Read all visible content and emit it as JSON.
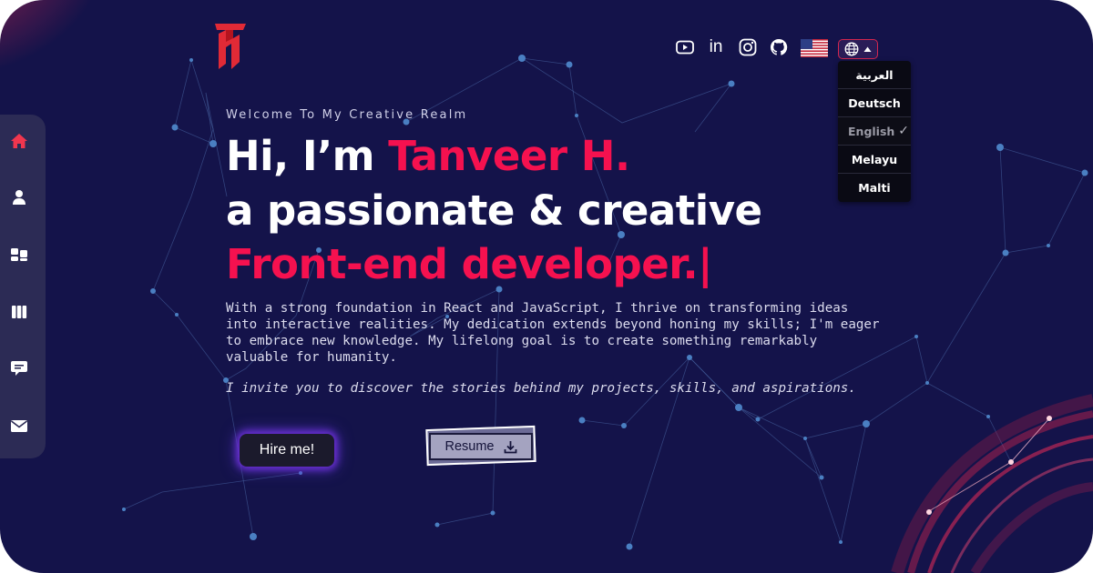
{
  "header": {
    "social": [
      {
        "name": "youtube",
        "icon": "youtube-icon"
      },
      {
        "name": "linkedin",
        "icon": "linkedin-icon",
        "text": "in"
      },
      {
        "name": "instagram",
        "icon": "instagram-icon"
      },
      {
        "name": "github",
        "icon": "github-icon"
      }
    ],
    "flag_icon": "us-flag-icon",
    "language_toggle_icon": "globe-icon",
    "languages": [
      {
        "label": "العربية",
        "selected": false
      },
      {
        "label": "Deutsch",
        "selected": false
      },
      {
        "label": "English",
        "selected": true
      },
      {
        "label": "Melayu",
        "selected": false
      },
      {
        "label": "Malti",
        "selected": false
      }
    ]
  },
  "sidebar": {
    "items": [
      {
        "name": "home",
        "icon": "home-icon",
        "active": true
      },
      {
        "name": "about",
        "icon": "user-icon",
        "active": false
      },
      {
        "name": "services",
        "icon": "dashboard-icon",
        "active": false
      },
      {
        "name": "portfolio",
        "icon": "columns-icon",
        "active": false
      },
      {
        "name": "testimonials",
        "icon": "comment-icon",
        "active": false
      },
      {
        "name": "contact",
        "icon": "mail-icon",
        "active": false
      }
    ]
  },
  "hero": {
    "welcome": "Welcome To My Creative Realm",
    "greeting": "Hi, I’m ",
    "name": "Tanveer H.",
    "line2": "a passionate & creative",
    "line3": "Front-end developer.|",
    "intro": "With a strong foundation in React and JavaScript, I thrive on transforming ideas into interactive realities. My dedication extends beyond honing my skills; I'm eager to embrace new knowledge. My lifelong goal is to create something remarkably valuable for humanity.",
    "invite": "I invite you to discover the stories behind my projects, skills, and aspirations.",
    "hire_label": "Hire me!",
    "resume_label": "Resume"
  },
  "colors": {
    "background": "#14134a",
    "accent": "#f5114f",
    "sidebar": "#2c2b55",
    "active_icon": "#f0364e"
  }
}
